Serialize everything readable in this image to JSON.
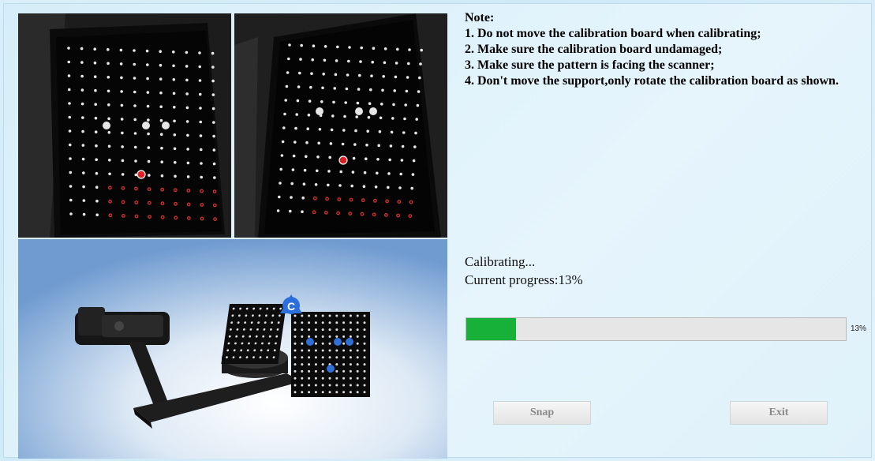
{
  "note": {
    "title": "Note:",
    "items": [
      "1. Do not move the calibration board when calibrating;",
      "2. Make sure the calibration board undamaged;",
      "3. Make sure the pattern is facing the scanner;",
      "4. Don't move the support,only rotate the calibration board as shown."
    ]
  },
  "status": {
    "line1": "Calibrating...",
    "line2": "Current progress:13%"
  },
  "progress": {
    "value": 13,
    "label": "13%",
    "fill_color": "#17b13a"
  },
  "buttons": {
    "snap": "Snap",
    "exit": "Exit"
  },
  "scene": {
    "badge_letter": "C"
  }
}
